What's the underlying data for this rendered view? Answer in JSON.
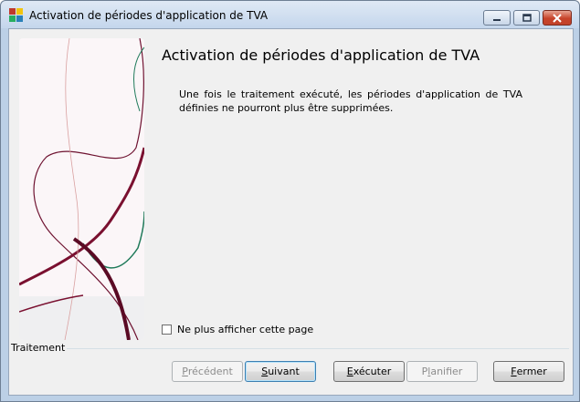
{
  "window": {
    "title": "Activation de périodes d'application de TVA"
  },
  "page": {
    "heading": "Activation de périodes d'application de TVA",
    "description": "Une fois le traitement exécuté, les périodes d'application de TVA définies ne pourront plus être supprimées.",
    "checkbox_label": "Ne plus afficher cette page",
    "checkbox_checked": false
  },
  "footer": {
    "group_label": "Traitement",
    "buttons": [
      {
        "label": "Précédent",
        "mnemonic": "P",
        "rest": "récédent",
        "enabled": false
      },
      {
        "label": "Suivant",
        "mnemonic": "S",
        "rest": "uivant",
        "enabled": true
      },
      {
        "label": "Exécuter",
        "mnemonic": "E",
        "rest": "xécuter",
        "enabled": true
      },
      {
        "label": "Planifier",
        "mnemonic": "l",
        "pre": "P",
        "rest": "anifier",
        "enabled": false
      },
      {
        "label": "Fermer",
        "mnemonic": "F",
        "rest": "ermer",
        "enabled": true
      }
    ]
  },
  "colors": {
    "curve_dark": "#6e1230",
    "curve_green": "#1f7a5a",
    "curve_pink": "#d9a0a0"
  },
  "icons": {
    "app": "app-icon",
    "minimize": "minimize-icon",
    "maximize": "maximize-icon",
    "close": "close-icon"
  }
}
